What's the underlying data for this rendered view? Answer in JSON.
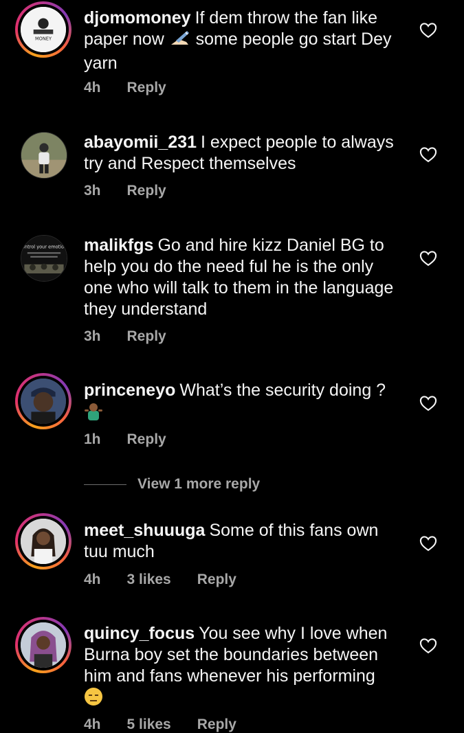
{
  "comments": [
    {
      "username": "djomomoney",
      "text_before": "If dem throw the fan like paper now",
      "emoji": "writing-hand",
      "text_after": "some people go start Dey yarn",
      "time": "4h",
      "likes": "",
      "reply_label": "Reply",
      "avatar_text": "MONEY"
    },
    {
      "username": "abayomii_231",
      "text": "I expect people to always try and Respect themselves",
      "time": "3h",
      "likes": "",
      "reply_label": "Reply"
    },
    {
      "username": "malikfgs",
      "text": "Go and hire kizz Daniel BG to help you do the need ful he is the only one who will talk to them in the language they understand",
      "time": "3h",
      "likes": "",
      "reply_label": "Reply",
      "avatar_text": "Control your emotions"
    },
    {
      "username": "princeneyo",
      "text": "What’s the security doing ?",
      "emoji": "person-shrugging",
      "time": "1h",
      "likes": "",
      "reply_label": "Reply"
    },
    {
      "username": "meet_shuuuga",
      "text": "Some of this fans own tuu much",
      "time": "4h",
      "likes": "3 likes",
      "reply_label": "Reply"
    },
    {
      "username": "quincy_focus",
      "text": "You see why I love when Burna boy set the boundaries between him and fans whenever his performing",
      "emoji": "expressionless-face",
      "time": "4h",
      "likes": "5 likes",
      "reply_label": "Reply"
    }
  ],
  "view_more_replies": "View 1 more reply",
  "colors": {
    "background": "#000000",
    "text": "#f5f5f5",
    "meta": "#a8a8a8",
    "story_ring": [
      "#f7a21b",
      "#e1306c",
      "#833ab4"
    ]
  }
}
